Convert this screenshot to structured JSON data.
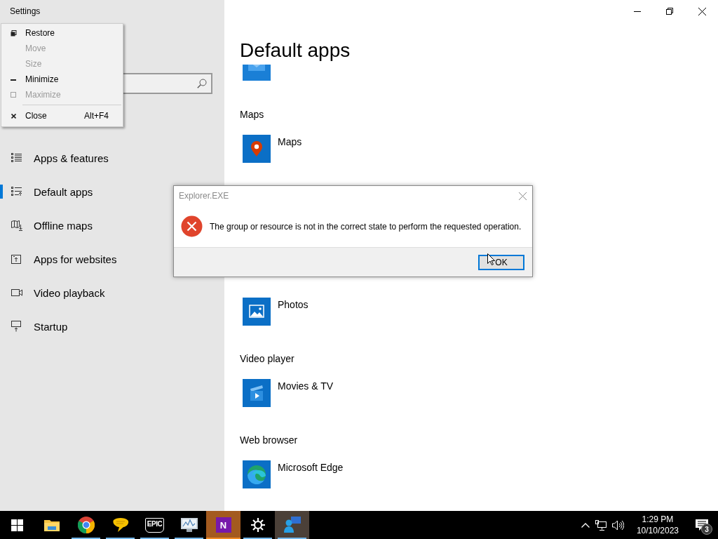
{
  "window": {
    "title": "Settings"
  },
  "system_menu": {
    "items": [
      {
        "label": "Restore",
        "kind": "restore",
        "disabled": false
      },
      {
        "label": "Move",
        "kind": "plain",
        "disabled": true
      },
      {
        "label": "Size",
        "kind": "plain",
        "disabled": true
      },
      {
        "label": "Minimize",
        "kind": "minimize",
        "disabled": false
      },
      {
        "label": "Maximize",
        "kind": "maximize",
        "disabled": true
      },
      {
        "label": "Close",
        "kind": "close",
        "disabled": false,
        "shortcut": "Alt+F4"
      }
    ]
  },
  "sidebar": {
    "items": [
      {
        "label": "Apps & features",
        "kind": "list",
        "selected": false
      },
      {
        "label": "Default apps",
        "kind": "defaults",
        "selected": true
      },
      {
        "label": "Offline maps",
        "kind": "map",
        "selected": false
      },
      {
        "label": "Apps for websites",
        "kind": "web",
        "selected": false
      },
      {
        "label": "Video playback",
        "kind": "video",
        "selected": false
      },
      {
        "label": "Startup",
        "kind": "startup",
        "selected": false
      }
    ]
  },
  "page": {
    "title": "Default apps",
    "partial_app": {
      "kind": "mail"
    },
    "sections": [
      {
        "heading": "Maps",
        "app": "Maps",
        "kind": "maps"
      },
      {
        "app": "Photos",
        "kind": "photos"
      },
      {
        "heading": "Video player",
        "app": "Movies & TV",
        "kind": "movies"
      },
      {
        "heading": "Web browser",
        "app": "Microsoft Edge",
        "kind": "edge"
      }
    ]
  },
  "dialog": {
    "title": "Explorer.EXE",
    "message": "The group or resource is not in the correct state to perform the requested operation.",
    "buttons": [
      {
        "label": "OK",
        "focused": true
      }
    ]
  },
  "taskbar": {
    "apps": [
      {
        "kind": "explorer",
        "running": false,
        "flashing": false,
        "selected": false
      },
      {
        "kind": "chrome",
        "running": true,
        "flashing": false,
        "selected": false
      },
      {
        "kind": "chat",
        "running": true,
        "flashing": false,
        "selected": false
      },
      {
        "kind": "epic",
        "glyph": "EPIC",
        "running": true,
        "flashing": false,
        "selected": false
      },
      {
        "kind": "photo",
        "running": true,
        "flashing": false,
        "selected": false
      },
      {
        "kind": "onenote",
        "glyph": "N",
        "running": true,
        "flashing": true,
        "selected": false
      },
      {
        "kind": "settings",
        "running": true,
        "flashing": false,
        "selected": false
      },
      {
        "kind": "people",
        "running": true,
        "flashing": false,
        "selected": true
      }
    ],
    "clock": {
      "time": "1:29 PM",
      "date": "10/10/2023"
    },
    "notifications": {
      "count": "3"
    }
  }
}
